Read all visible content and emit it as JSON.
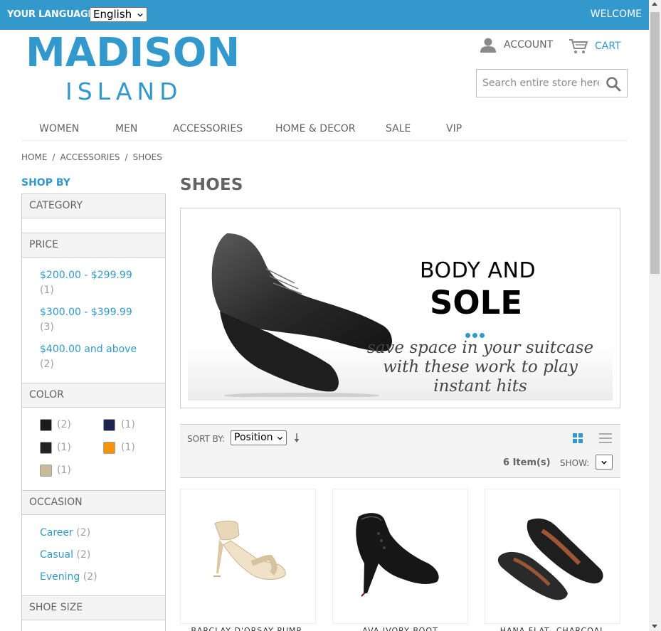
{
  "header": {
    "language_label": "YOUR LANGUAGE:",
    "language_value": "English",
    "welcome": "WELCOME",
    "brand_color": "#3399cc"
  },
  "logo": {
    "line1": "MADISON",
    "line2": "ISLAND"
  },
  "account": {
    "label": "ACCOUNT",
    "icon": "user-icon"
  },
  "cart": {
    "label": "CART",
    "icon": "cart-icon"
  },
  "search": {
    "placeholder": "Search entire store here...",
    "icon": "search-icon"
  },
  "nav": {
    "items": [
      "WOMEN",
      "MEN",
      "ACCESSORIES",
      "HOME & DECOR",
      "SALE",
      "VIP"
    ]
  },
  "breadcrumb": {
    "items": [
      "HOME",
      "ACCESSORIES",
      "SHOES"
    ],
    "separator": "/"
  },
  "sidebar": {
    "title": "SHOP BY",
    "category": {
      "title": "CATEGORY"
    },
    "price": {
      "title": "PRICE",
      "ranges": [
        {
          "label": "$200.00 - $299.99",
          "count": "(1)"
        },
        {
          "label": "$300.00 - $399.99",
          "count": "(3)"
        },
        {
          "label": "$400.00 and above",
          "count": "(2)"
        }
      ]
    },
    "color": {
      "title": "COLOR",
      "swatches": [
        {
          "color": "#1a1a1a",
          "count": "(2)"
        },
        {
          "color": "#1c2350",
          "count": "(1)"
        },
        {
          "color": "#222222",
          "count": "(1)"
        },
        {
          "color": "#f5930a",
          "count": "(1)"
        },
        {
          "color": "#c9b99b",
          "count": "(1)"
        }
      ]
    },
    "occasion": {
      "title": "OCCASION",
      "items": [
        {
          "label": "Career",
          "count": "(2)"
        },
        {
          "label": "Casual",
          "count": "(2)"
        },
        {
          "label": "Evening",
          "count": "(2)"
        }
      ]
    },
    "shoe_size": {
      "title": "SHOE SIZE"
    }
  },
  "main": {
    "title": "SHOES",
    "banner": {
      "heading1": "BODY AND",
      "heading2": "SOLE",
      "tagline": "save space in your suitcase with these work to play instant hits"
    },
    "toolbar": {
      "sort_label": "SORT BY:",
      "sort_value": "Position",
      "items_count": "6 Item(s)",
      "show_label": "SHOW:"
    },
    "products": [
      {
        "name": "BARCLAY D'ORSAY PUMP, NUDE",
        "image": "nude-heeled-sandal"
      },
      {
        "name": "AVA IVORY BOOT",
        "image": "black-platform-bootie"
      },
      {
        "name": "HANA FLAT, CHARCOAL",
        "image": "black-flat-shoe"
      }
    ]
  }
}
